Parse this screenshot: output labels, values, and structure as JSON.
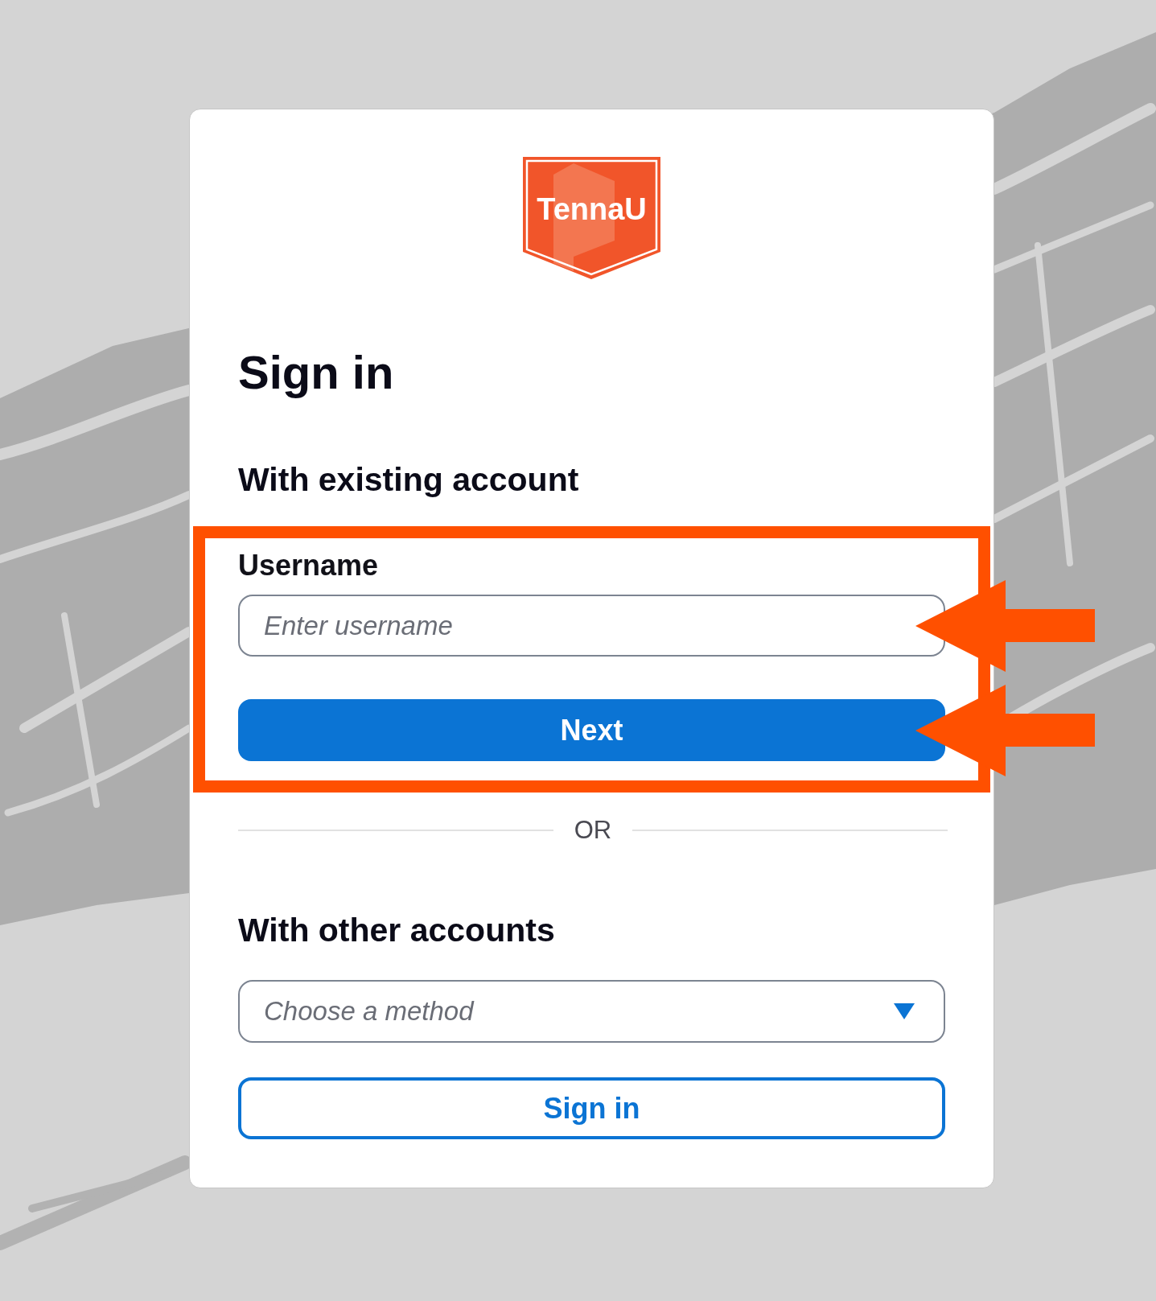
{
  "logo": {
    "text": "TennaU"
  },
  "title": "Sign in",
  "existing": {
    "heading": "With existing account",
    "highlighted": true,
    "username": {
      "label": "Username",
      "placeholder": "Enter username",
      "arrow": true
    },
    "next_button": {
      "label": "Next",
      "arrow": true
    }
  },
  "divider": {
    "text": "OR"
  },
  "other": {
    "heading": "With other accounts",
    "method": {
      "placeholder": "Choose a method"
    },
    "sign_in_button": {
      "label": "Sign in"
    }
  }
}
